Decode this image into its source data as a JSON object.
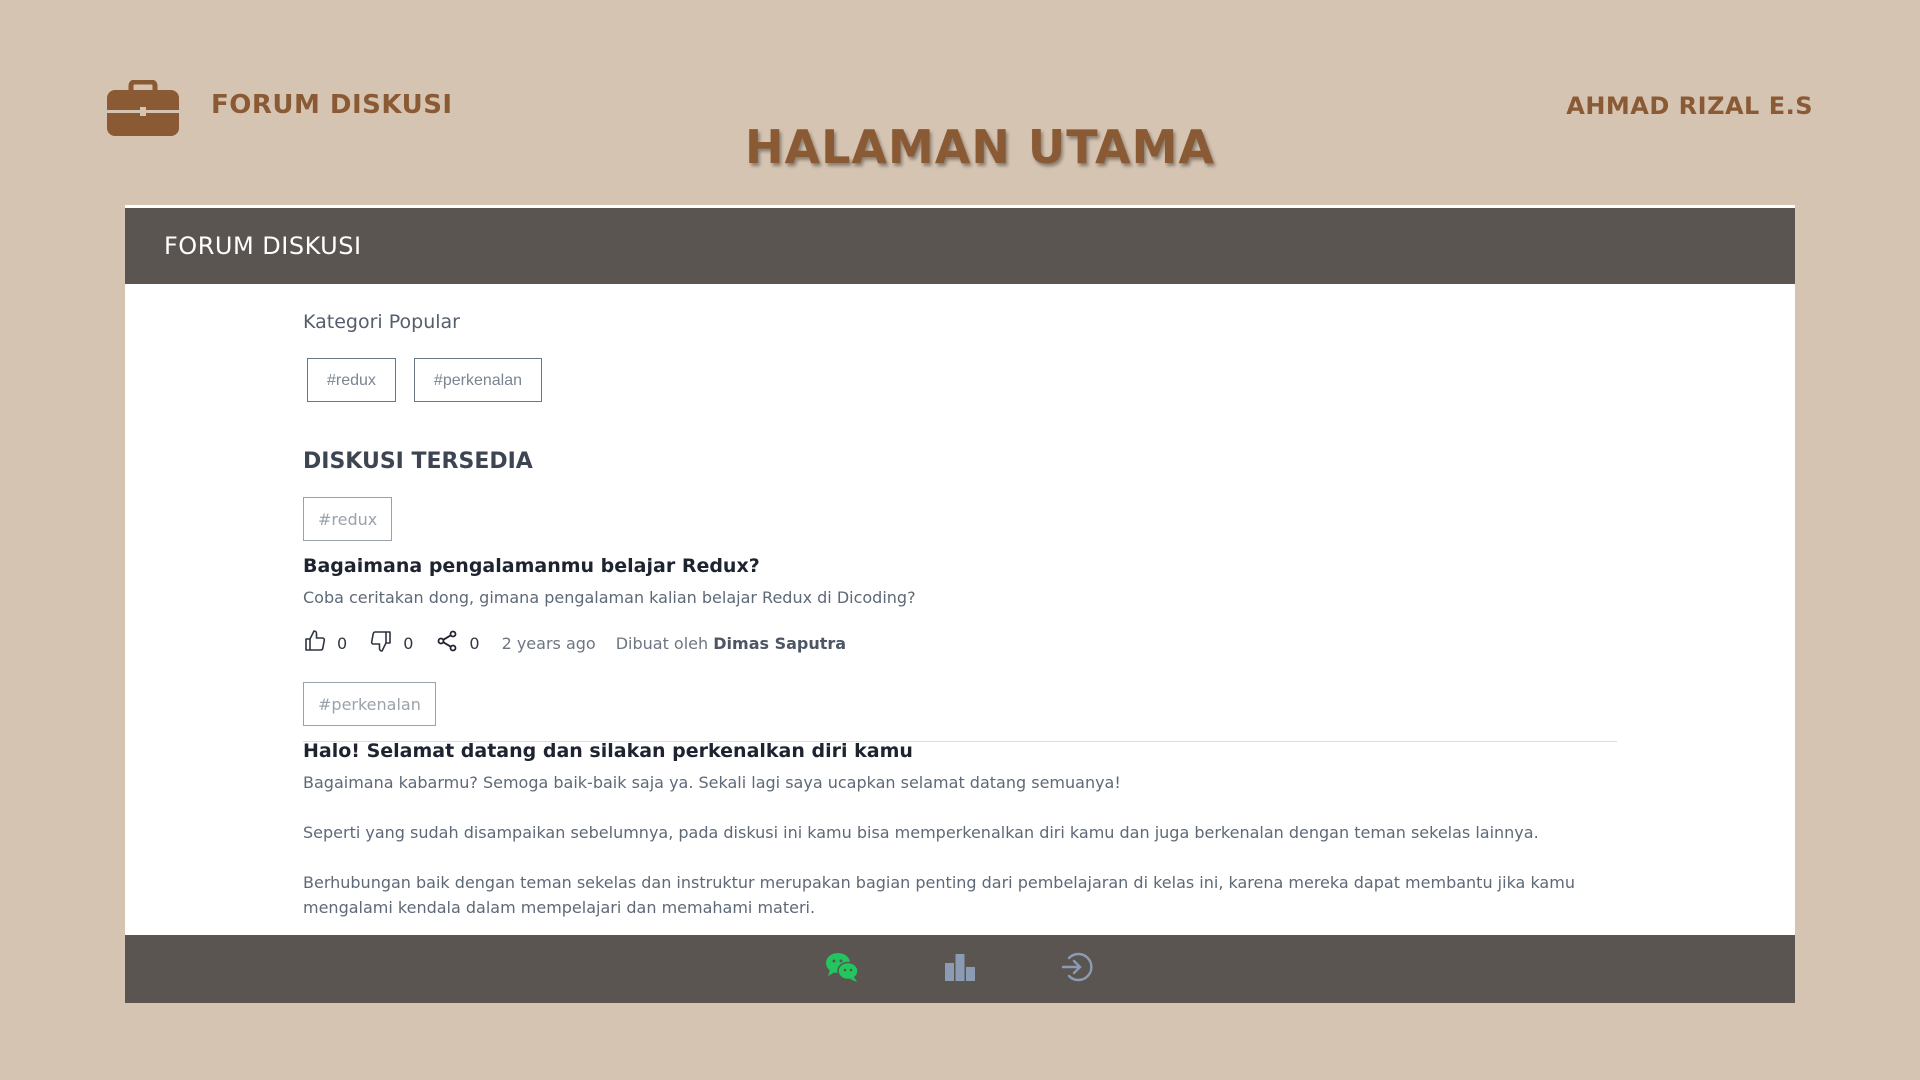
{
  "slide": {
    "brand": "FORUM DISKUSI",
    "title": "HALAMAN UTAMA",
    "author": "AHMAD RIZAL E.S",
    "icon": "briefcase-icon"
  },
  "app": {
    "header_title": "FORUM DISKUSI",
    "popular_label": "Kategori Popular",
    "categories": [
      "#redux",
      "#perkenalan"
    ],
    "available_title": "DISKUSI TERSEDIA",
    "threads": [
      {
        "tag": "#redux",
        "title": "Bagaimana pengalamanmu belajar Redux?",
        "body": [
          "Coba ceritakan dong, gimana pengalaman kalian belajar Redux di Dicoding?"
        ],
        "likes": "0",
        "dislikes": "0",
        "shares": "0",
        "time": "2 years ago",
        "created_by_label": "Dibuat oleh",
        "author": "Dimas Saputra"
      },
      {
        "tag": "#perkenalan",
        "title": "Halo! Selamat datang dan silakan perkenalkan diri kamu",
        "body": [
          "Bagaimana kabarmu? Semoga baik-baik saja ya. Sekali lagi saya ucapkan selamat datang semuanya!",
          "Seperti yang sudah disampaikan sebelumnya, pada diskusi ini kamu bisa memperkenalkan diri kamu dan juga berkenalan dengan teman sekelas lainnya.",
          "Berhubungan baik dengan teman sekelas dan instruktur merupakan bagian penting dari pembelajaran di kelas ini, karena mereka dapat membantu jika kamu mengalami kendala dalam mempelajari dan memahami materi."
        ]
      }
    ],
    "bottom_nav": [
      {
        "icon": "chat-icon",
        "color": "#22c55e"
      },
      {
        "icon": "leaderboard-icon",
        "color": "#8b9bb4"
      },
      {
        "icon": "logout-icon",
        "color": "#8b9bb4"
      }
    ]
  }
}
